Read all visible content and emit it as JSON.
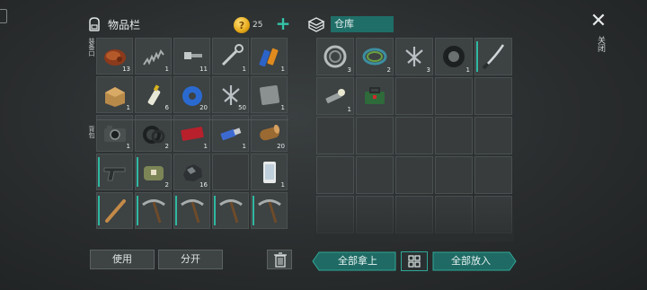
{
  "inventory": {
    "title": "物品栏",
    "coin_count": "25",
    "side_label_top": "装备口",
    "side_label_bottom": "背包",
    "slots": [
      {
        "name": "meat-icon",
        "count": "13"
      },
      {
        "name": "spring-icon",
        "count": "1"
      },
      {
        "name": "bolt-icon",
        "count": "11"
      },
      {
        "name": "wrench-icon",
        "count": "1"
      },
      {
        "name": "battery-icon",
        "count": "1"
      },
      {
        "name": "box-icon",
        "count": "1"
      },
      {
        "name": "glue-icon",
        "count": "6"
      },
      {
        "name": "tape-icon",
        "count": "20"
      },
      {
        "name": "nails-icon",
        "count": "50"
      },
      {
        "name": "metal-plate-icon",
        "count": "1"
      },
      {
        "name": "camera-icon",
        "count": "1"
      },
      {
        "name": "rubber-ring-icon",
        "count": "2"
      },
      {
        "name": "ticket-icon",
        "count": "1"
      },
      {
        "name": "usb-icon",
        "count": "1"
      },
      {
        "name": "log-icon",
        "count": "20"
      },
      {
        "name": "pistol-icon",
        "count": ""
      },
      {
        "name": "medkit-bag-icon",
        "count": "2"
      },
      {
        "name": "rock-icon",
        "count": "16"
      },
      {
        "name": "empty",
        "count": ""
      },
      {
        "name": "phone-icon",
        "count": "1"
      },
      {
        "name": "bat-icon",
        "count": ""
      },
      {
        "name": "pickaxe-icon",
        "count": ""
      },
      {
        "name": "pickaxe-icon",
        "count": ""
      },
      {
        "name": "pickaxe-icon",
        "count": ""
      },
      {
        "name": "pickaxe-icon",
        "count": ""
      }
    ]
  },
  "warehouse": {
    "title": "仓库",
    "slots": [
      {
        "name": "bearing-icon",
        "count": "3"
      },
      {
        "name": "wire-coil-icon",
        "count": "2"
      },
      {
        "name": "nails-icon",
        "count": "3"
      },
      {
        "name": "tire-icon",
        "count": "1"
      },
      {
        "name": "katana-icon",
        "count": ""
      },
      {
        "name": "flashlight-icon",
        "count": "1"
      },
      {
        "name": "toolbox-icon",
        "count": ""
      }
    ]
  },
  "actions": {
    "use": "使用",
    "split": "分开",
    "take_all": "全部拿上",
    "put_all": "全部放入",
    "close": "关闭"
  },
  "colors": {
    "accent": "#1f6e68",
    "teal": "#2fb8a2",
    "coin": "#e5a818"
  }
}
